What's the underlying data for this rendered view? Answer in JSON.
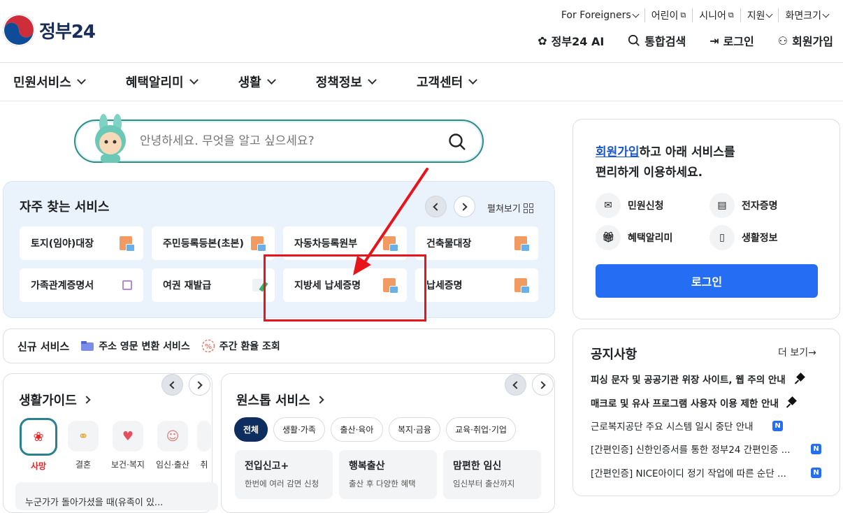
{
  "header": {
    "logo_text": "정부24",
    "util": [
      "For Foreigners",
      "어린이",
      "시니어",
      "지원",
      "화면크기"
    ],
    "tools": [
      "정부24 AI",
      "통합검색",
      "로그인",
      "회원가입"
    ]
  },
  "gnb": [
    "민원서비스",
    "혜택알리미",
    "생활",
    "정책정보",
    "고객센터"
  ],
  "search": {
    "placeholder": "안녕하세요. 무엇을 알고 싶으세요?"
  },
  "frequent": {
    "title": "자주 찾는 서비스",
    "expand_label": "펼쳐보기",
    "items": [
      "토지(임야)대장",
      "주민등록등본(초본)",
      "자동차등록원부",
      "건축물대장",
      "가족관계증명서",
      "여권 재발급",
      "지방세 납세증명",
      "납세증명"
    ]
  },
  "new_services": {
    "title": "신규 서비스",
    "items": [
      "주소 영문 변환 서비스",
      "주간 환율 조회"
    ]
  },
  "life_guide": {
    "title": "생활가이드",
    "items": [
      "사망",
      "결혼",
      "보건·복지",
      "임신·출산",
      "취"
    ],
    "snippet": "누군가가 돌아가셨을 때(유족이 있..."
  },
  "onestop": {
    "title": "원스톱 서비스",
    "chips": [
      "전체",
      "생활·가족",
      "출산·육아",
      "복지·금융",
      "교육·취업·기업"
    ],
    "cards": [
      {
        "title": "전입신고+",
        "sub": "한번에 여러 감면 신청"
      },
      {
        "title": "행복출산",
        "sub": "출산 후 다양한 혜택"
      },
      {
        "title": "맘편한 임신",
        "sub": "임신부터 출산까지"
      }
    ]
  },
  "login": {
    "msg_link": "회원가입",
    "msg_rest": "하고 아래 서비스를",
    "msg_line2": "편리하게 이용하세요.",
    "quick": [
      "민원신청",
      "전자증명",
      "혜택알리미",
      "생활정보"
    ],
    "button": "로그인"
  },
  "notice": {
    "title": "공지사항",
    "more": "더 보기→",
    "items": [
      {
        "text": "피싱 문자 및 공공기관 위장 사이트, 웹 주의 안내",
        "mark": "pin"
      },
      {
        "text": "매크로 및 유사 프로그램 사용자 이용 제한 안내",
        "mark": "pin"
      },
      {
        "text": "근로복지공단 주요 시스템 일시 중단 안내",
        "mark": "N"
      },
      {
        "text": "[간편인증] 신한인증서를 통한 정부24 간편인증 ...",
        "mark": "N"
      },
      {
        "text": "[간편인증] NICE아이디 정기 작업에 따른 순단 ...",
        "mark": "N"
      }
    ]
  },
  "colors": {
    "accent": "#256ef4",
    "annotation": "#e8141b",
    "navy": "#0d2e5e"
  }
}
